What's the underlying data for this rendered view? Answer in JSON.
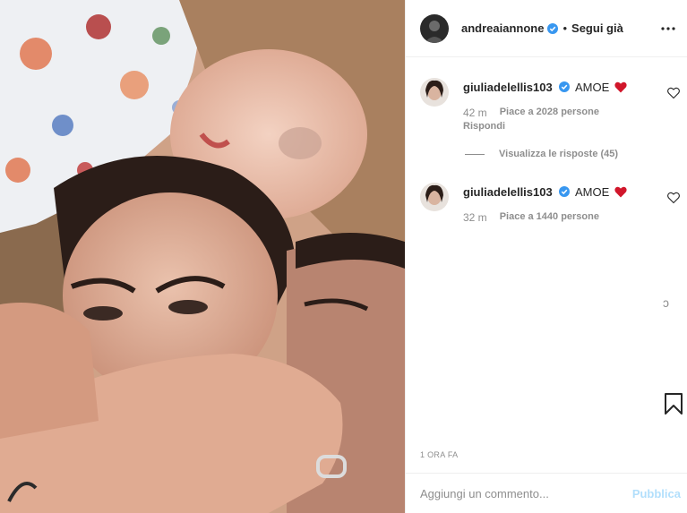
{
  "header": {
    "username": "andreaiannone",
    "separator": "•",
    "follow_label": "Segui già"
  },
  "comments": [
    {
      "username": "giuliadelellis103",
      "text": "AMOE",
      "time": "42 m",
      "likes": "Piace a 2028 persone",
      "reply_label": "Rispondi"
    },
    {
      "username": "giuliadelellis103",
      "text": "AMOE",
      "time": "32 m",
      "likes": "Piace a 1440 persone"
    }
  ],
  "view_replies": "Visualizza le risposte (45)",
  "loader_glyph": "ↄ",
  "timestamp": "1 ORA FA",
  "add_comment": {
    "placeholder": "Aggiungi un commento...",
    "publish_label": "Pubblica"
  },
  "colors": {
    "verified": "#3897f0",
    "heart": "#d1162b",
    "publish_disabled": "#b2dffc"
  }
}
